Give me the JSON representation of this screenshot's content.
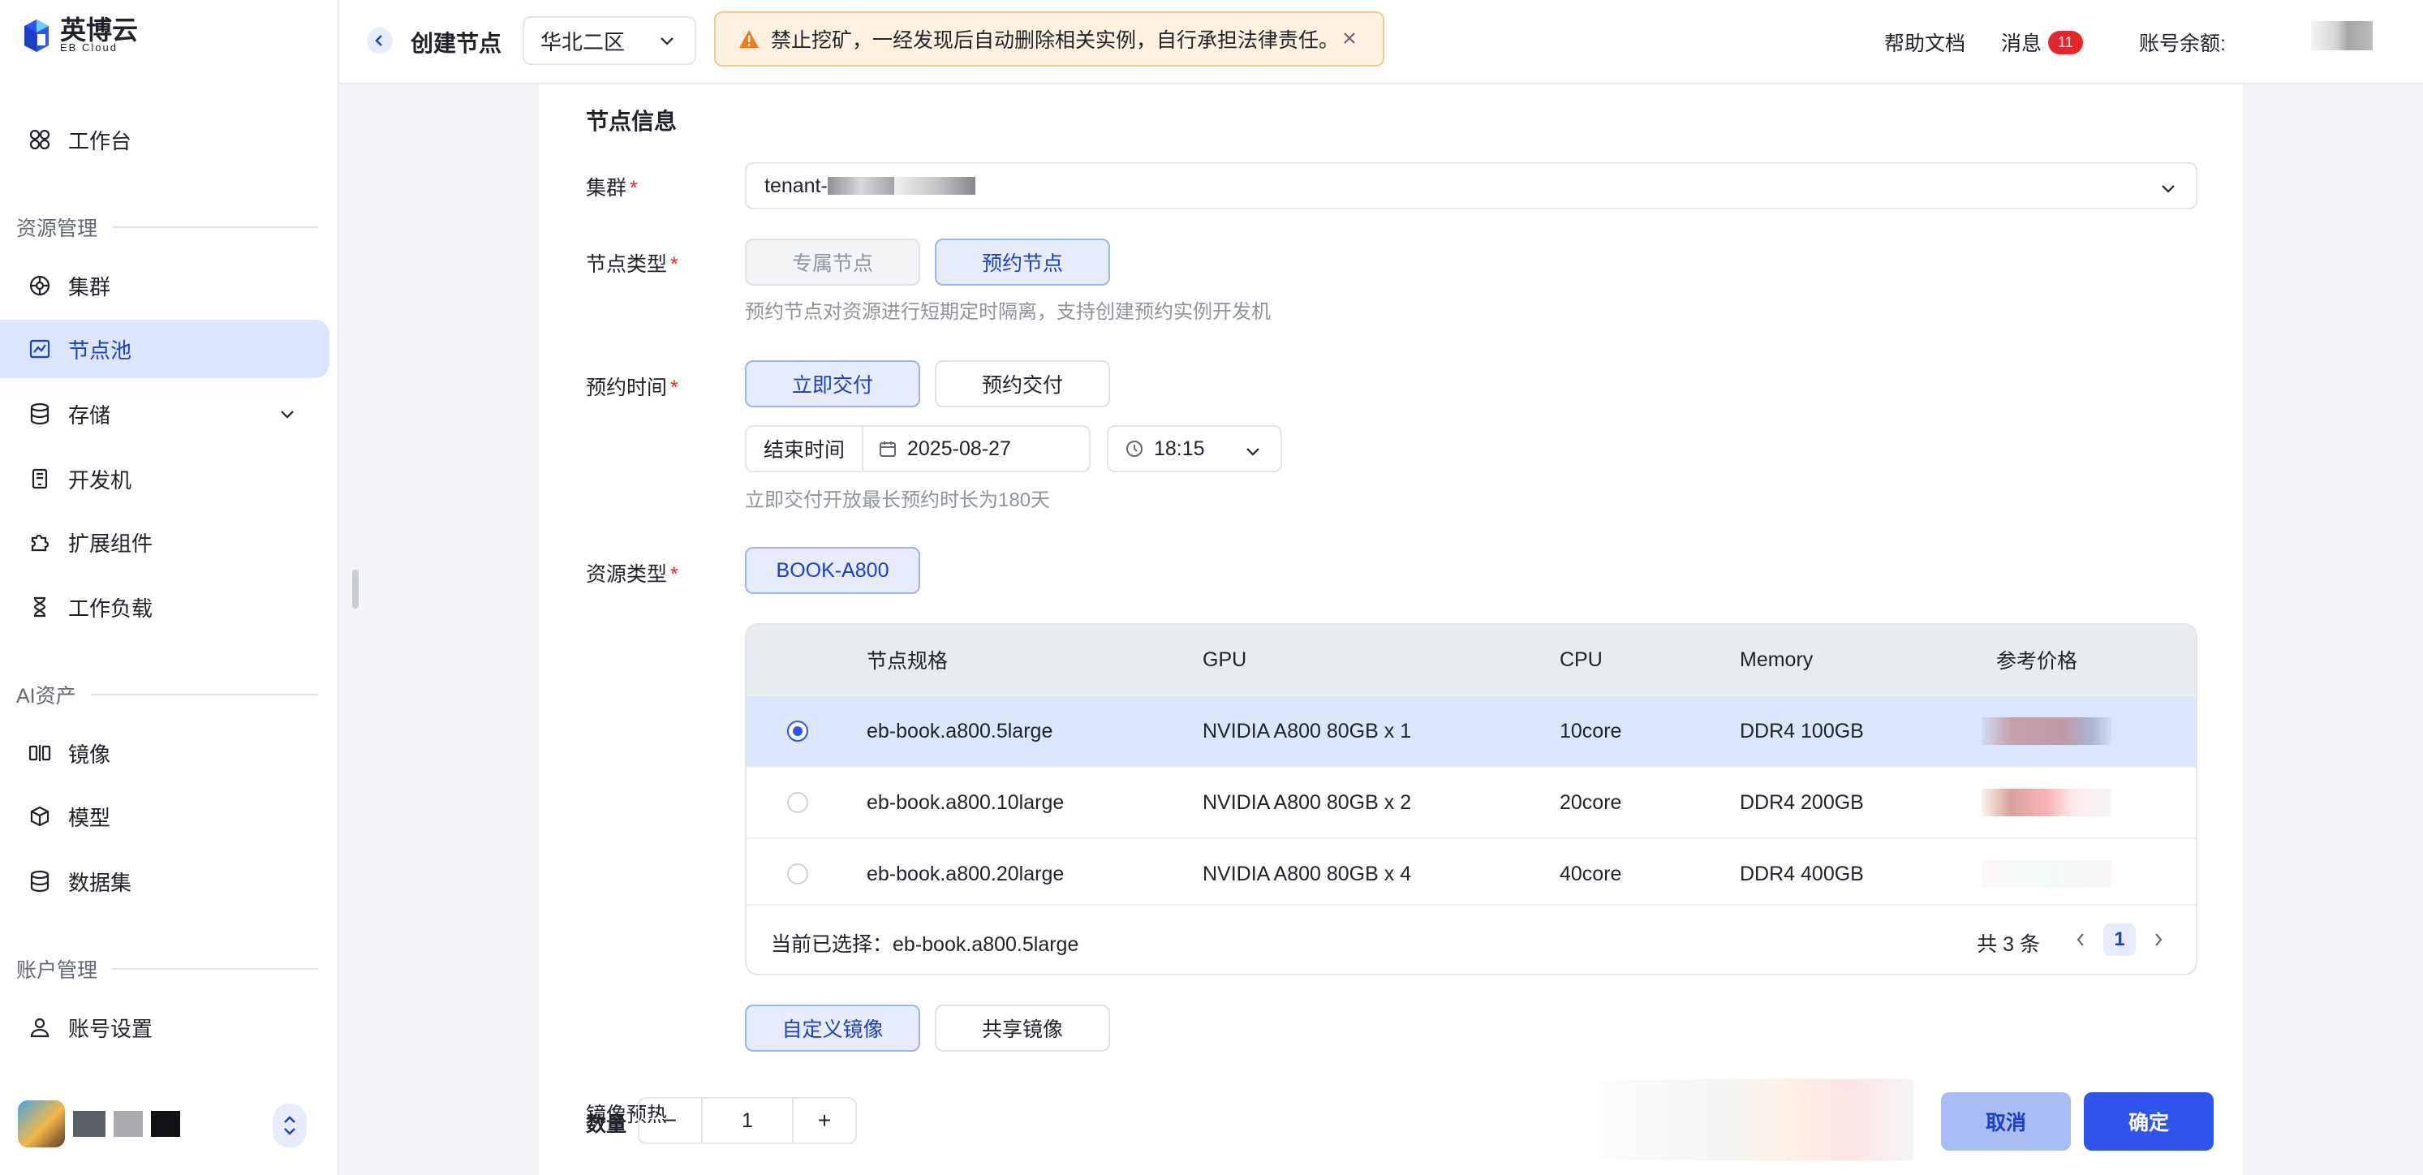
{
  "brand": {
    "name": "英博云",
    "sub": "EB Cloud"
  },
  "sidebar": {
    "workbench": "工作台",
    "section_resource": "资源管理",
    "cluster": "集群",
    "node_pool": "节点池",
    "storage": "存储",
    "devbox": "开发机",
    "extensions": "扩展组件",
    "workload": "工作负载",
    "section_ai": "AI资产",
    "image": "镜像",
    "model": "模型",
    "dataset": "数据集",
    "section_account": "账户管理",
    "account_settings": "账号设置"
  },
  "header": {
    "title": "创建节点",
    "region": "华北二区",
    "warning": "禁止挖矿，一经发现后自动删除相关实例，自行承担法律责任。",
    "help": "帮助文档",
    "messages": "消息",
    "message_count": "11",
    "balance_label": "账号余额:"
  },
  "form": {
    "section_title": "节点信息",
    "cluster_label": "集群",
    "cluster_value": "tenant-",
    "node_type_label": "节点类型",
    "node_type_dedicated": "专属节点",
    "node_type_reserved": "预约节点",
    "node_type_hint": "预约节点对资源进行短期定时隔离，支持创建预约实例开发机",
    "reserve_time_label": "预约时间",
    "deliver_now": "立即交付",
    "deliver_scheduled": "预约交付",
    "end_time_label": "结束时间",
    "end_date": "2025-08-27",
    "end_time": "18:15",
    "reserve_hint": "立即交付开放最长预约时长为180天",
    "resource_type_label": "资源类型",
    "resource_type": "BOOK-A800",
    "image_preheat_label": "镜像预热",
    "custom_image": "自定义镜像",
    "shared_image": "共享镜像",
    "quantity_label": "数量",
    "quantity": "1",
    "minus": "−",
    "plus": "+"
  },
  "table": {
    "headers": [
      "节点规格",
      "GPU",
      "CPU",
      "Memory",
      "参考价格"
    ],
    "rows": [
      {
        "spec": "eb-book.a800.5large",
        "gpu": "NVIDIA A800 80GB x 1",
        "cpu": "10core",
        "memory": "DDR4 100GB"
      },
      {
        "spec": "eb-book.a800.10large",
        "gpu": "NVIDIA A800 80GB x 2",
        "cpu": "20core",
        "memory": "DDR4 200GB"
      },
      {
        "spec": "eb-book.a800.20large",
        "gpu": "NVIDIA A800 80GB x 4",
        "cpu": "40core",
        "memory": "DDR4 400GB"
      }
    ],
    "selected_label": "当前已选择：",
    "selected_value": "eb-book.a800.5large",
    "total": "共 3 条",
    "page": "1"
  },
  "actions": {
    "cancel": "取消",
    "confirm": "确定"
  },
  "colors": {
    "accent": "#2f54eb",
    "active_bg": "#dbe5fb",
    "warning_bg": "#fdf1e1",
    "badge": "#e5262d"
  }
}
